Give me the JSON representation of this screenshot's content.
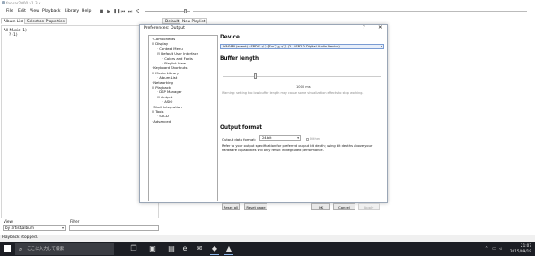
{
  "window": {
    "title": "foobar2000 v1.3.x"
  },
  "menu": [
    "File",
    "Edit",
    "View",
    "Playback",
    "Library",
    "Help"
  ],
  "toolbar": {
    "stop": "■",
    "play": "▶",
    "pause": "❚❚",
    "prev": "⏮",
    "next": "⏭",
    "rand": "⤭",
    "playback_order": "▾"
  },
  "left_tabs": [
    "Album List",
    "Selection Properties"
  ],
  "right_tabs": [
    "Default",
    "New Playlist"
  ],
  "album_list": {
    "root": "All Music (1)",
    "child": "? (1)"
  },
  "view": {
    "label": "View",
    "value": "by artist/album"
  },
  "filter": {
    "label": "Filter"
  },
  "status": "Playback stopped.",
  "dialog": {
    "title": "Preferences: Output",
    "help": "?",
    "close": "✕",
    "nav": [
      {
        "label": "Components",
        "level": 0,
        "toggle": ""
      },
      {
        "label": "Display",
        "level": 0,
        "toggle": "−"
      },
      {
        "label": "Context Menu",
        "level": 1,
        "toggle": ""
      },
      {
        "label": "Default User Interface",
        "level": 1,
        "toggle": "−"
      },
      {
        "label": "Colors and Fonts",
        "level": 2,
        "toggle": ""
      },
      {
        "label": "Playlist View",
        "level": 2,
        "toggle": ""
      },
      {
        "label": "Keyboard Shortcuts",
        "level": 0,
        "toggle": ""
      },
      {
        "label": "Media Library",
        "level": 0,
        "toggle": "−"
      },
      {
        "label": "Album List",
        "level": 1,
        "toggle": ""
      },
      {
        "label": "Networking",
        "level": 0,
        "toggle": ""
      },
      {
        "label": "Playback",
        "level": 0,
        "toggle": "−"
      },
      {
        "label": "DSP Manager",
        "level": 1,
        "toggle": ""
      },
      {
        "label": "Output",
        "level": 1,
        "toggle": "−"
      },
      {
        "label": "ASIO",
        "level": 2,
        "toggle": ""
      },
      {
        "label": "Shell Integration",
        "level": 0,
        "toggle": ""
      },
      {
        "label": "Tools",
        "level": 0,
        "toggle": "−"
      },
      {
        "label": "SACD",
        "level": 1,
        "toggle": ""
      },
      {
        "label": "Advanced",
        "level": 0,
        "toggle": ""
      }
    ],
    "device": {
      "heading": "Device",
      "value": "WASAPI (event) : SPDIF インターフェイス (2- USB2.0 Digital Audio Device)"
    },
    "buffer": {
      "heading": "Buffer length",
      "value_text": "1000 ms",
      "level": 0.2,
      "warning": "Warning: setting too low buffer length may cause some visualization effects to stop working."
    },
    "format": {
      "heading": "Output format",
      "label": "Output data format:",
      "value": "24-bit",
      "dither": "Dither",
      "note": "Refer to your output specification for preferred output bit depth; using bit depths above your hardware capabilities will only result in degraded performance."
    },
    "buttons": {
      "reset_all": "Reset all",
      "reset_page": "Reset page",
      "ok": "OK",
      "cancel": "Cancel",
      "apply": "Apply"
    }
  },
  "taskbar": {
    "search_placeholder": "ここに入力して検索",
    "time": "21:07",
    "date": "2015/09/19"
  }
}
